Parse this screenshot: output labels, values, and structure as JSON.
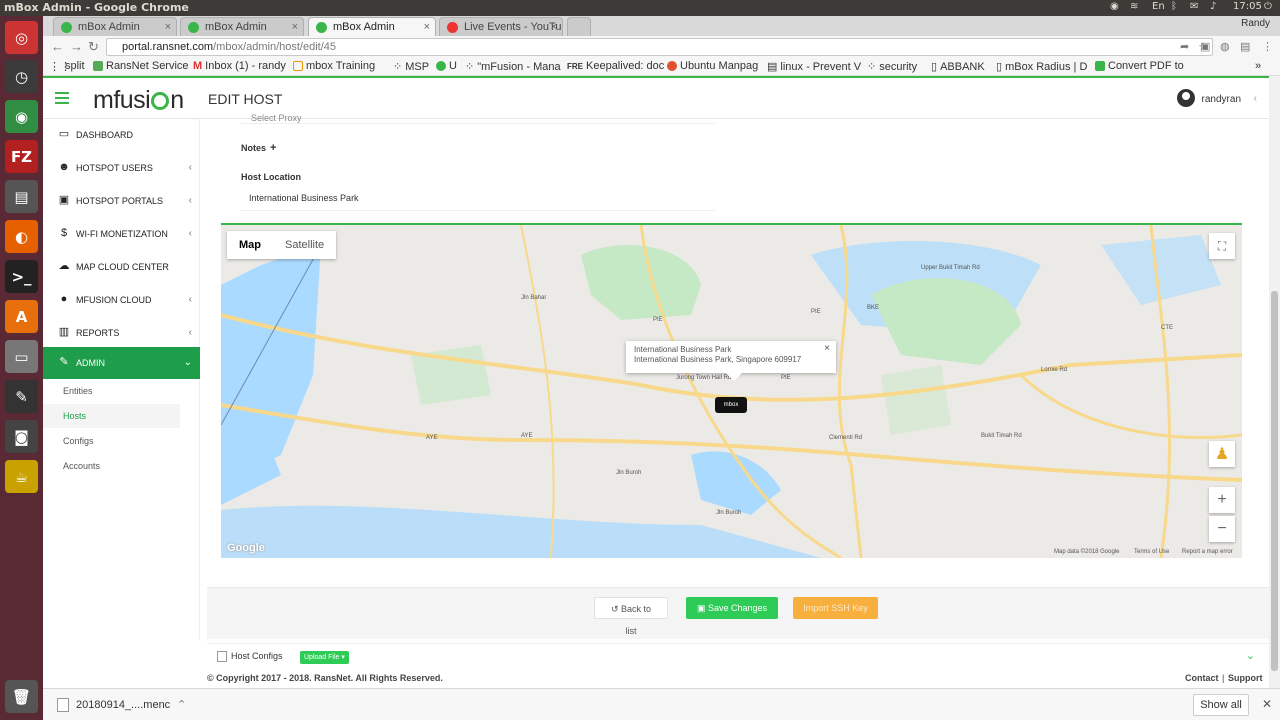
{
  "os": {
    "window_title": "mBox Admin - Google Chrome",
    "time": "17:05",
    "lang": "En"
  },
  "launcher": [
    "chrome-icon",
    "clock-icon",
    "chrome-icon",
    "filezilla-icon",
    "files-icon",
    "firefox-icon",
    "terminal-icon",
    "software-icon",
    "window-icon",
    "editor-icon",
    "camera-icon",
    "teapot-icon",
    "trash-icon"
  ],
  "browser": {
    "tabs": [
      {
        "label": "mBox Admin",
        "active": false
      },
      {
        "label": "mBox Admin",
        "active": false
      },
      {
        "label": "mBox Admin",
        "active": true
      },
      {
        "label": "Live Events - YouTu",
        "active": false
      }
    ],
    "user": "Randy",
    "url_host": "portal.ransnet.com",
    "url_path": "/mbox/admin/host/edit/45",
    "bookmarks": [
      "split",
      "RansNet Service",
      "Inbox (1) - randy",
      "mbox Training",
      "MSP",
      "U",
      "\"mFusion - Mana",
      "Keepalived: doc",
      "Ubuntu Manpag",
      "linux - Prevent V",
      "security",
      "ABBANK",
      "mBox Radius | D",
      "Convert PDF to"
    ]
  },
  "header": {
    "logo_left": "mfusi",
    "logo_right": "n",
    "page_title": "EDIT HOST",
    "username": "randyran"
  },
  "sidebar": {
    "items": [
      {
        "label": "DASHBOARD",
        "icon": "monitor-icon",
        "chevron": ""
      },
      {
        "label": "HOTSPOT USERS",
        "icon": "users-icon",
        "chevron": "‹"
      },
      {
        "label": "HOTSPOT PORTALS",
        "icon": "portal-icon",
        "chevron": "‹"
      },
      {
        "label": "WI-FI MONETIZATION",
        "icon": "dollar-icon",
        "chevron": "‹"
      },
      {
        "label": "MAP CLOUD CENTER",
        "icon": "cloud-icon",
        "chevron": ""
      },
      {
        "label": "MFUSION CLOUD",
        "icon": "globe-icon",
        "chevron": "‹"
      },
      {
        "label": "REPORTS",
        "icon": "chart-icon",
        "chevron": "‹"
      },
      {
        "label": "ADMIN",
        "icon": "wrench-icon",
        "chevron": "⌄"
      }
    ],
    "subitems": [
      "Entities",
      "Hosts",
      "Configs",
      "Accounts"
    ],
    "active_sub": "Hosts"
  },
  "form": {
    "proxy_placeholder": "Select Proxy",
    "notes_label": "Notes",
    "notes_add": "+",
    "location_label": "Host Location",
    "location_value": "International Business Park"
  },
  "map": {
    "tab_map": "Map",
    "tab_satellite": "Satellite",
    "info_title": "International Business Park",
    "info_address": "International Business Park, Singapore 609917",
    "info_close": "×",
    "marker_label": "mbox",
    "google": "Google",
    "footer_data": "Map data ©2018 Google",
    "footer_terms": "Terms of Use",
    "footer_report": "Report a map error",
    "zoom_in": "+",
    "zoom_out": "−",
    "roads": [
      "PIE",
      "AYE",
      "AYE",
      "PIE",
      "BKE",
      "PIE",
      "CTE",
      "Jln Bahar",
      "Jurong Town Hall Rd",
      "Bukit Timah Rd",
      "Jln Buroh",
      "Clementi Rd",
      "Lornie Rd",
      "Jln Buroh",
      "Upper Bukit Timah Rd"
    ],
    "colors": {
      "land": "#eceae6",
      "water": "#aadaff",
      "park": "#c5e8c5",
      "road": "#f8d98b"
    }
  },
  "actions": {
    "back": "Back to list",
    "save": "Save Changes",
    "import": "Import SSH Key"
  },
  "host_configs": {
    "title": "Host Configs",
    "upload": "Upload File ▾"
  },
  "footer": {
    "copyright": "© Copyright 2017 - 2018. RansNet. All Rights Reserved.",
    "contact": "Contact",
    "sep": "|",
    "support": "Support"
  },
  "download": {
    "file": "20180914_....menc",
    "show_all": "Show all"
  }
}
